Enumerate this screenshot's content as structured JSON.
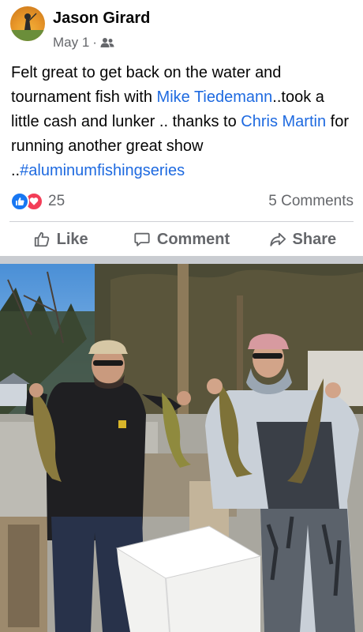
{
  "post": {
    "author": "Jason Girard",
    "date": "May 1",
    "separator": "·",
    "audience_icon": "friends-icon",
    "text_parts": {
      "t1": "Felt great to get back on the water and tournament fish with ",
      "mention1": "Mike Tiedemann",
      "t2": "..took a little cash and lunker .. thanks to ",
      "mention2": "Chris Martin",
      "t3": " for running another great show ..",
      "hashtag": "#aluminumfishingseries"
    }
  },
  "stats": {
    "reaction_count": "25",
    "reaction_icons": [
      "like-reaction-icon",
      "love-reaction-icon"
    ],
    "comments": "5 Comments"
  },
  "actions": {
    "like": "Like",
    "comment": "Comment",
    "share": "Share"
  },
  "colors": {
    "link": "#1e6ae0",
    "like_blue": "#1877f2",
    "love_red": "#f33e58",
    "muted": "#65676b"
  }
}
